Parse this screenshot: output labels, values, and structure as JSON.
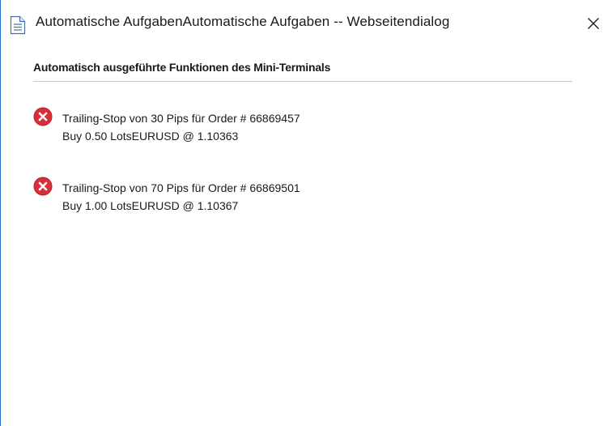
{
  "window": {
    "title": "Automatische AufgabenAutomatische Aufgaben -- Webseitendialog",
    "close_icon": "close-icon",
    "page_icon": "document-icon"
  },
  "content": {
    "section_header": "Automatisch ausgeführte Funktionen des Mini-Terminals",
    "tasks": [
      {
        "status_icon": "error-icon",
        "line1": "Trailing-Stop von 30 Pips für Order # 66869457",
        "line2": "Buy 0.50 LotsEURUSD @ 1.10363"
      },
      {
        "status_icon": "error-icon",
        "line1": "Trailing-Stop von 70 Pips für Order # 66869501",
        "line2": "Buy 1.00 LotsEURUSD @ 1.10367"
      }
    ]
  },
  "colors": {
    "error_red": "#d8303a",
    "window_border": "#1f74d2",
    "divider": "#c8c8c8"
  }
}
